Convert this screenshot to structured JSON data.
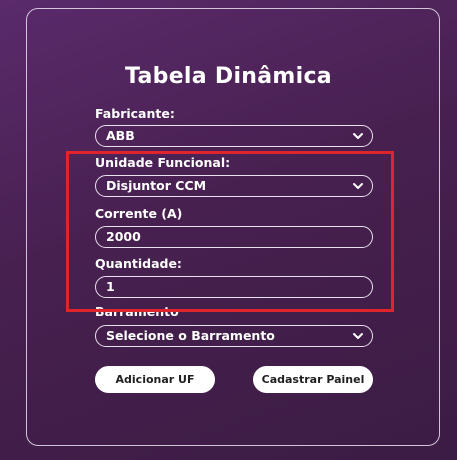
{
  "form": {
    "title": "Tabela Dinâmica",
    "fabricante": {
      "label": "Fabricante:",
      "value": "ABB"
    },
    "unidade_funcional": {
      "label": "Unidade Funcional:",
      "value": "Disjuntor CCM"
    },
    "corrente": {
      "label": "Corrente (A)",
      "value": "2000"
    },
    "quantidade": {
      "label": "Quantidade:",
      "value": "1"
    },
    "barramento": {
      "label": "Barramento",
      "value": "Selecione o Barramento"
    },
    "buttons": {
      "adicionar": "Adicionar UF",
      "cadastrar": "Cadastrar Painel"
    }
  },
  "icons": {
    "select_chevron": "chevron-down-icon"
  },
  "colors": {
    "background": "#47204f",
    "highlight": "#e0242c",
    "button_bg": "#ffffff"
  }
}
